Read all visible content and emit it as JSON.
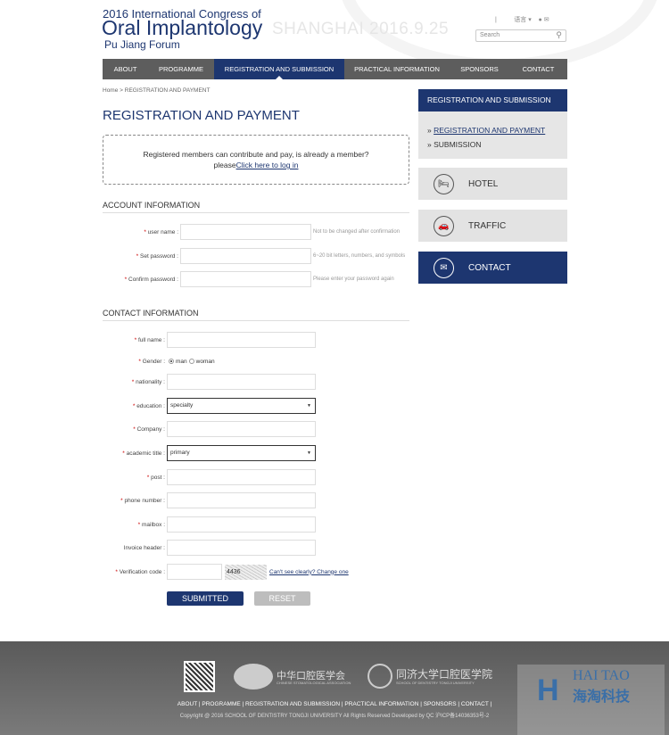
{
  "header": {
    "line1": "2016 International Congress of",
    "line2": "Oral Implantology",
    "line3": "Pu Jiang Forum",
    "tagline": "SHANGHAI 2016.9.25",
    "language": "语言",
    "search_placeholder": "Search"
  },
  "nav": [
    {
      "label": "ABOUT"
    },
    {
      "label": "PROGRAMME"
    },
    {
      "label": "REGISTRATION AND SUBMISSION",
      "active": true
    },
    {
      "label": "PRACTICAL INFORMATION"
    },
    {
      "label": "SPONSORS"
    },
    {
      "label": "CONTACT"
    }
  ],
  "breadcrumb": "Home > REGISTRATION AND PAYMENT",
  "page_title": "REGISTRATION AND PAYMENT",
  "notice": {
    "text": "Registered members can contribute and pay, is already a member?",
    "prefix": "please",
    "link": "Click here to log in"
  },
  "account": {
    "title": "ACCOUNT INFORMATION",
    "fields": [
      {
        "label": "user name :",
        "hint": "Not to be changed after confirmation"
      },
      {
        "label": "Set password :",
        "hint": "6~20 bit letters, numbers, and symbols"
      },
      {
        "label": "Confirm password :",
        "hint": "Please enter your password again"
      }
    ]
  },
  "contact": {
    "title": "CONTACT INFORMATION",
    "full_name": "full name :",
    "gender": "Gender :",
    "man": "man",
    "woman": "woman",
    "nationality": "nationality :",
    "education": "education :",
    "education_value": "specialty",
    "company": "Company :",
    "academic_title": "academic title :",
    "academic_value": "primary",
    "post": "post :",
    "phone": "phone number :",
    "mailbox": "mailbox :",
    "invoice": "Invoice header :",
    "verification": "Verification code :",
    "captcha": "4436",
    "change": "Can't see clearly? Change one"
  },
  "buttons": {
    "submit": "SUBMITTED",
    "reset": "RESET"
  },
  "sidebar": {
    "title": "REGISTRATION AND SUBMISSION",
    "items": [
      "REGISTRATION AND PAYMENT",
      "SUBMISSION"
    ],
    "hotel": "HOTEL",
    "traffic": "TRAFFIC",
    "contact": "CONTACT"
  },
  "footer": {
    "logo1": "中华口腔医学会",
    "logo1_sub": "CHINESE STOMATOLOGICAL ASSOCIATION",
    "logo2": "同济大学口腔医学院",
    "logo2_sub": "SCHOOL OF DENTISTRY TONGJI UNIVERSITY",
    "links": "ABOUT | PROGRAMME | REGISTRATION AND SUBMISSION | PRACTICAL INFORMATION | SPONSORS | CONTACT |",
    "copyright": "Copyright @ 2016 SCHOOL OF DENTISTRY TONGJI UNIVERSITY All Rights Reserved    Developed by QC 沪ICP备14036353号-2"
  },
  "watermark": {
    "en": "HAI TAO",
    "cn": "海淘科技"
  },
  "colors": {
    "brand": "#1d3670",
    "nav": "#5d5d5d",
    "footer": "#6b6b6b"
  }
}
